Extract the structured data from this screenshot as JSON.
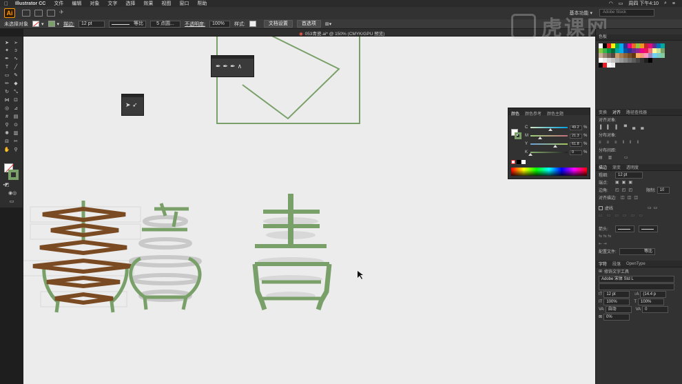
{
  "menubar": {
    "app": "Illustrator CC",
    "items": [
      "文件",
      "编辑",
      "对象",
      "文字",
      "选择",
      "效果",
      "视图",
      "窗口",
      "帮助"
    ],
    "time": "周四 下午4:10"
  },
  "appbar": {
    "logo": "Ai",
    "workspace": "基本功能 ▾",
    "search_placeholder": "Adobe Stock"
  },
  "controlbar": {
    "selection": "未选择对象",
    "stroke_label": "描边:",
    "stroke_value": "12 pt",
    "profile": "等比",
    "brush": "5 点圆...",
    "opacity_label": "不透明度:",
    "opacity_value": "100%",
    "style_label": "样式:",
    "doc_setup": "文档设置",
    "prefs": "首选项"
  },
  "document": {
    "tab": "053青瓷.ai* @ 150% (CMYK/GPU 预览)"
  },
  "color_panel": {
    "tabs": [
      "颜色",
      "颜色参考",
      "颜色主题"
    ],
    "channels": [
      {
        "name": "C",
        "value": "49.2",
        "unit": "%",
        "fraction": 0.49,
        "color": "#00a0e0"
      },
      {
        "name": "M",
        "value": "21.3",
        "unit": "%",
        "fraction": 0.21,
        "color": "#e0009a"
      },
      {
        "name": "Y",
        "value": "61.8",
        "unit": "%",
        "fraction": 0.62,
        "color": "#e6d800"
      },
      {
        "name": "K",
        "value": "0",
        "unit": "%",
        "fraction": 0.0,
        "color": "#888888"
      }
    ]
  },
  "right_panel": {
    "swatches_title": "色板",
    "transform_tabs": [
      "变换",
      "对齐",
      "路径查找器"
    ],
    "align_objects": "对齐对象:",
    "distribute_objects": "分布对象:",
    "distribute_spacing": "分布间距:",
    "stroke_tabs": [
      "描边",
      "渐变",
      "透明度"
    ],
    "weight_label": "粗细:",
    "weight_value": "12 pt",
    "cap_label": "端点:",
    "corner_label": "边角:",
    "limit_label": "限制:",
    "limit_value": "10",
    "align_stroke_label": "对齐描边:",
    "dashed_label": "虚线",
    "arrowheads_label": "箭头:",
    "profile_label": "配置文件:",
    "profile_value": "等比",
    "char_tabs": [
      "字符",
      "段落",
      "OpenType"
    ],
    "touch_type": "修饰文字工具",
    "font": "Adobe 宋体 Std L",
    "font_size": "12 pt",
    "leading": "(14.4 p",
    "scale_v": "100%",
    "scale_h": "100%",
    "kerning": "自动",
    "tracking": "0",
    "baseline": "0%"
  },
  "watermark": {
    "text": "虎课网"
  }
}
